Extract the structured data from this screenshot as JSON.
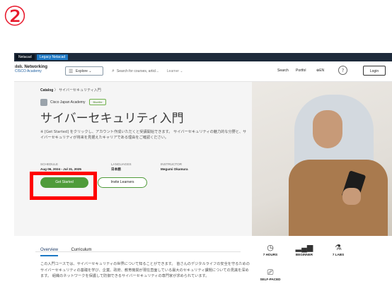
{
  "marker": "②",
  "top_tabs": [
    "Netacad",
    "Legacy Netacad"
  ],
  "logo": {
    "line1": "ılıılı. Networking",
    "line2": "CISCO Academy"
  },
  "nav": {
    "explore_label": "Explore",
    "search_placeholder": "Search for courses, articl...",
    "learner_label": "Learner",
    "search_label": "Search",
    "portfolio_label": "Portfol",
    "lang_label": "EN",
    "help": "?",
    "login_label": "Login"
  },
  "breadcrumb": {
    "catalog": "Catalog",
    "sep": "〉",
    "current": "サイバーセキュリティ入門"
  },
  "provider": {
    "name": "Cisco Japan Academy",
    "badge": "Bluelite"
  },
  "course": {
    "title": "サイバーセキュリティ入門",
    "description": "※ [Get Started] をクリックし、アカウント作成いただくと受講開始できます。 サイバーセキュリティの魅力的な分野と、サイバーセキュリティが将来を見据えたキャリアである理由をご確認ください。"
  },
  "meta": {
    "schedule_label": "SCHEDULE",
    "schedule_value": "Aug 06, 2024 - Jul 31, 2025",
    "language_label": "LANGUAGES",
    "language_value": "日本語",
    "instructor_label": "INSTRUCTOR",
    "instructor_value": "Megumi Okamura"
  },
  "actions": {
    "start": "Get Started",
    "invite": "Invite Learners"
  },
  "tabs": [
    "Overview",
    "Curriculum"
  ],
  "overview_text": "この入門コースでは、サイバーセキュリティの世界について知ることができます。 皆さんのデジタルライフの安全を守るための サイバーセキュリティの基礎を学び、企業、政府、教育機関が現在直面している最大のセキュリティ課題についての見識を深めます。 組織のネットワークを保護して防御できるサイバーセキュリティの専門家が求められています。",
  "facts": [
    {
      "icon": "clock-icon",
      "label": "7 HOURS"
    },
    {
      "icon": "bars-icon",
      "label": "BEGINNER"
    },
    {
      "icon": "flask-icon",
      "label": "7 LABS"
    },
    {
      "icon": "self-paced-icon",
      "label": "SELF-PACED"
    }
  ],
  "colors": {
    "accent_green": "#4f9b3a",
    "highlight_red": "#ff0000",
    "marker_red": "#e8192c",
    "topbar": "#1d2a3a"
  }
}
